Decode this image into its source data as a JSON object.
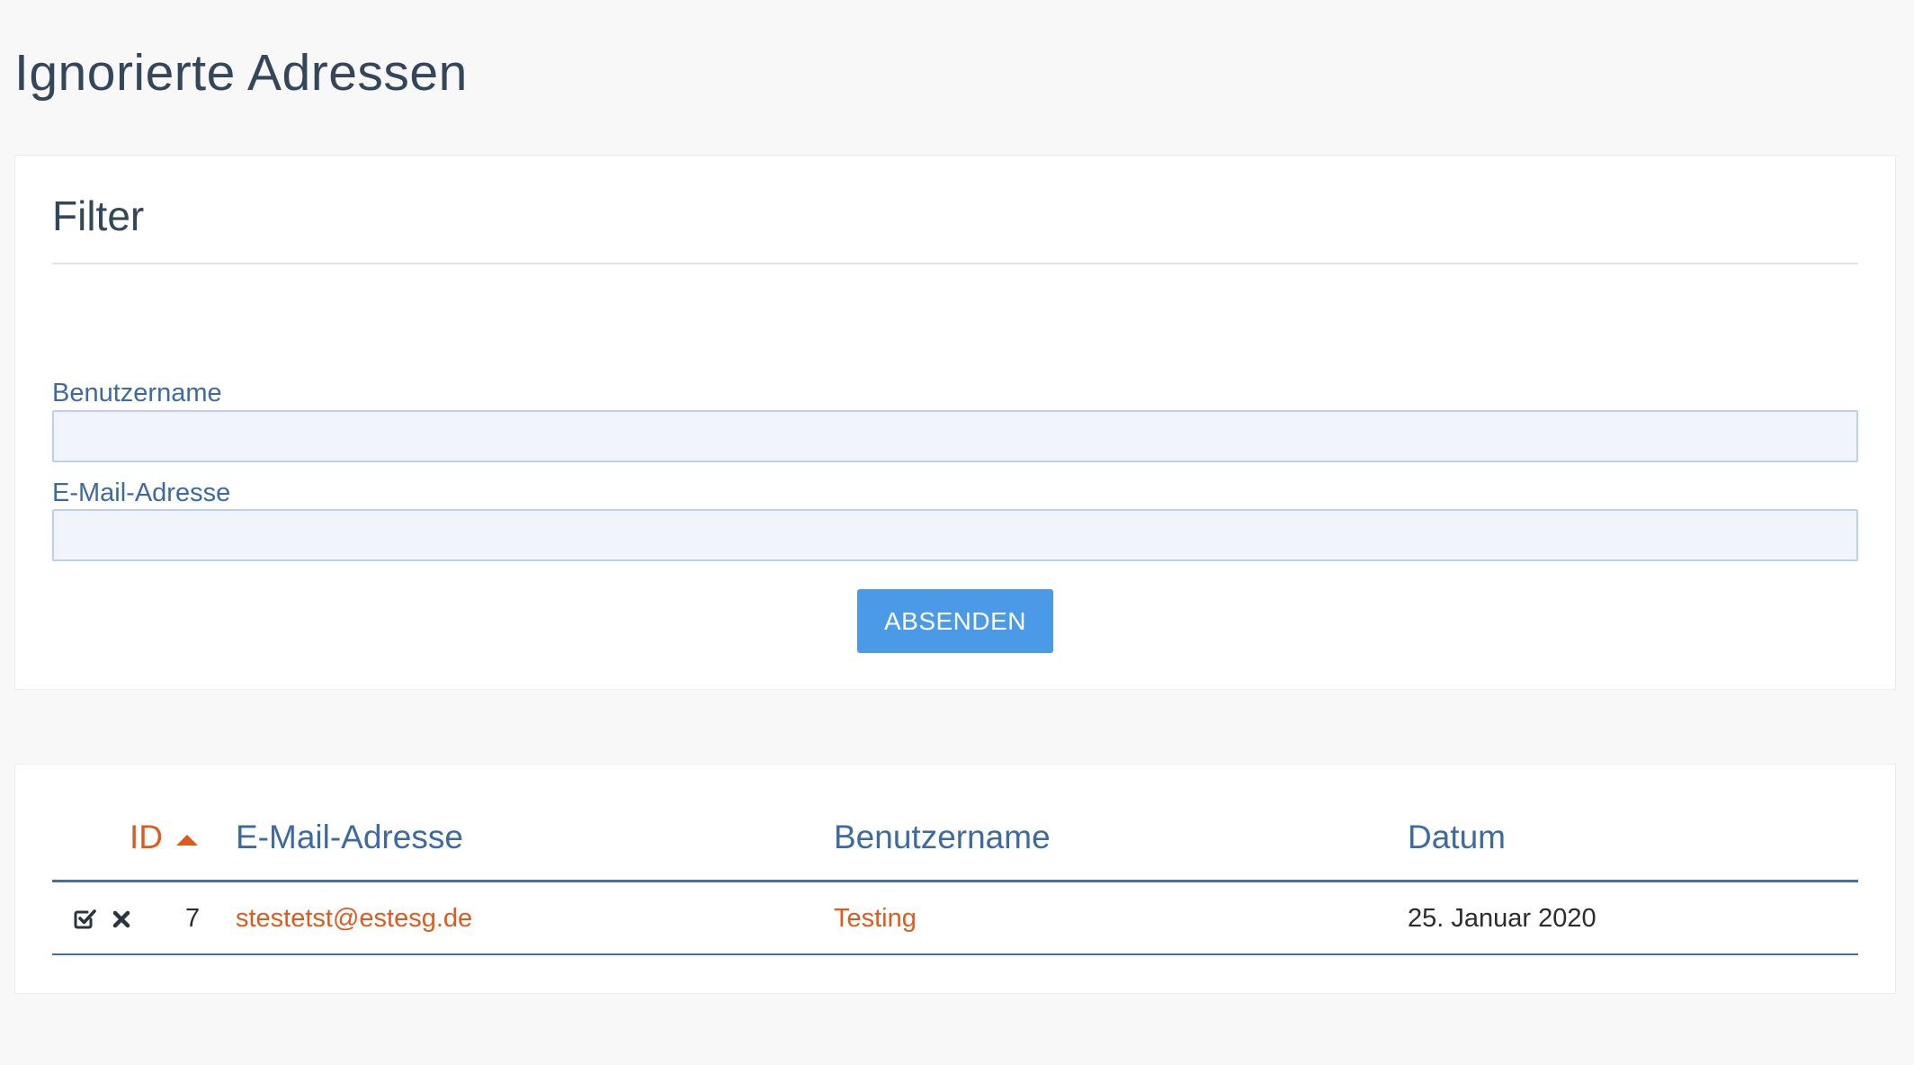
{
  "page": {
    "title": "Ignorierte Adressen"
  },
  "filter": {
    "title": "Filter",
    "username_label": "Benutzername",
    "username_value": "",
    "email_label": "E-Mail-Adresse",
    "email_value": "",
    "submit_label": "ABSENDEN"
  },
  "table": {
    "columns": {
      "id": "ID",
      "email": "E-Mail-Adresse",
      "username": "Benutzername",
      "date": "Datum"
    },
    "sort": {
      "column": "ID",
      "direction": "ascending"
    },
    "rows": [
      {
        "actions": [
          "check-square-icon",
          "close-icon"
        ],
        "id": "7",
        "email": "stestetst@estesg.de",
        "username": "Testing",
        "date": "25. Januar 2020"
      }
    ]
  },
  "colors": {
    "accent_orange": "#dd5b1f",
    "label_blue": "#3d6aa2",
    "button_blue": "#4b9ae8",
    "input_bg": "#f1f5fb"
  }
}
